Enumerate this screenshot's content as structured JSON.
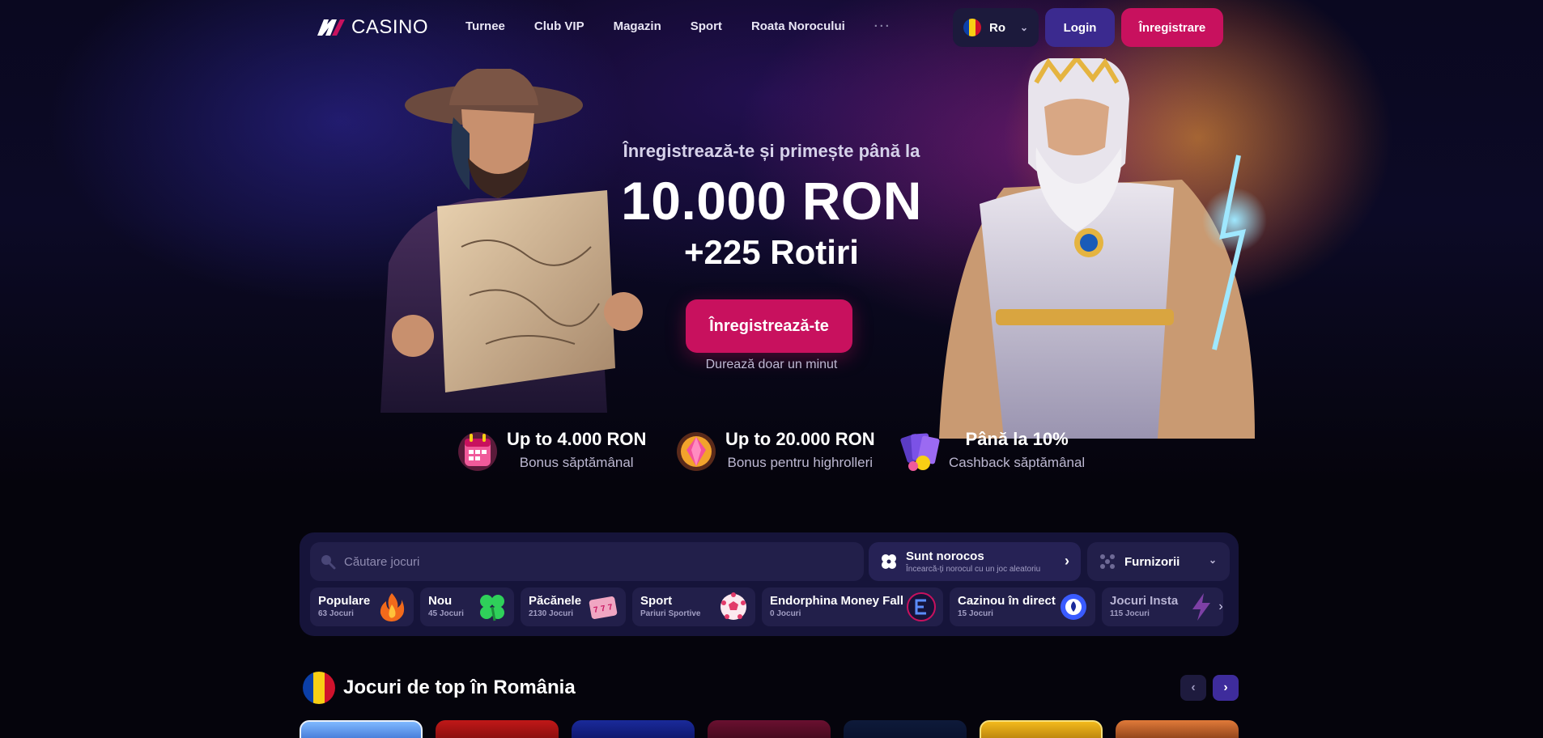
{
  "header": {
    "logo_text": "CASINO",
    "nav": [
      "Turnee",
      "Club VIP",
      "Magazin",
      "Sport",
      "Roata Norocului"
    ],
    "nav_more": "···",
    "language": "Ro",
    "login_label": "Login",
    "register_label": "Înregistrare"
  },
  "hero": {
    "subtitle": "Înregistrează-te și primește până la",
    "amount": "10.000 RON",
    "spins": "+225 Rotiri",
    "cta_label": "Înregistrează-te",
    "note": "Durează doar un minut"
  },
  "bonuses": [
    {
      "title": "Up to 4.000 RON",
      "subtitle": "Bonus săptămânal",
      "icon": "calendar-gift-icon"
    },
    {
      "title": "Up to 20.000 RON",
      "subtitle": "Bonus pentru highrolleri",
      "icon": "diamond-badge-icon"
    },
    {
      "title": "Până la 10%",
      "subtitle": "Cashback săptămânal",
      "icon": "cards-cashback-icon"
    }
  ],
  "search": {
    "placeholder": "Căutare jocuri",
    "lucky_title": "Sunt norocos",
    "lucky_subtitle": "Încearcă-ți norocul cu un joc aleatoriu",
    "providers_label": "Furnizorii"
  },
  "categories": [
    {
      "name": "Populare",
      "count": "63 Jocuri",
      "icon": "fire-icon"
    },
    {
      "name": "Nou",
      "count": "45 Jocuri",
      "icon": "clover-icon"
    },
    {
      "name": "Păcănele",
      "count": "2130 Jocuri",
      "icon": "slot-machine-icon"
    },
    {
      "name": "Sport",
      "count": "Pariuri Sportive",
      "icon": "soccer-ball-icon"
    },
    {
      "name": "Endorphina Money Fall",
      "count": "0 Jocuri",
      "icon": "endorphina-logo-icon"
    },
    {
      "name": "Cazinou în direct",
      "count": "15 Jocuri",
      "icon": "poker-chip-icon"
    },
    {
      "name": "Jocuri Insta",
      "count": "115 Jocuri",
      "icon": "lightning-icon"
    }
  ],
  "top_games": {
    "title": "Jocuri de top în România"
  },
  "colors": {
    "accent_pink": "#c8115e",
    "accent_purple": "#3b2a8f",
    "panel_bg": "#16143a"
  }
}
